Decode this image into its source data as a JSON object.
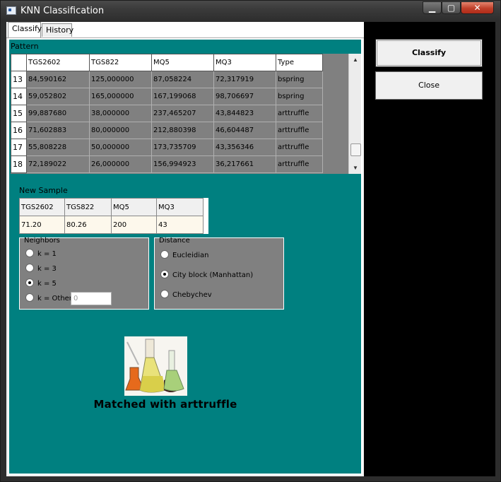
{
  "window": {
    "title": "KNN Classification",
    "min_label": "▁",
    "max_label": "▢",
    "close_label": "✕"
  },
  "tabs": [
    {
      "label": "Classify"
    },
    {
      "label": "History"
    }
  ],
  "pattern": {
    "label": "Pattern",
    "columns": [
      "TGS2602",
      "TGS822",
      "MQ5",
      "MQ3",
      "Type"
    ],
    "rows": [
      {
        "n": "13",
        "cells": [
          "84,590162",
          "125,000000",
          "87,058224",
          "72,317919",
          "bspring"
        ]
      },
      {
        "n": "14",
        "cells": [
          "59,052802",
          "165,000000",
          "167,199068",
          "98,706697",
          "bspring"
        ]
      },
      {
        "n": "15",
        "cells": [
          "99,887680",
          "38,000000",
          "237,465207",
          "43,844823",
          "arttruffle"
        ]
      },
      {
        "n": "16",
        "cells": [
          "71,602883",
          "80,000000",
          "212,880398",
          "46,604487",
          "arttruffle"
        ]
      },
      {
        "n": "17",
        "cells": [
          "55,808228",
          "50,000000",
          "173,735709",
          "43,356346",
          "arttruffle"
        ]
      },
      {
        "n": "18",
        "cells": [
          "72,189022",
          "26,000000",
          "156,994923",
          "36,217661",
          "arttruffle"
        ]
      }
    ]
  },
  "new_sample": {
    "label": "New Sample",
    "columns": [
      "TGS2602",
      "TGS822",
      "MQ5",
      "MQ3"
    ],
    "values": [
      "71.20",
      "80.26",
      "200",
      "43"
    ]
  },
  "neighbors": {
    "title": "Neighbors",
    "options": [
      "k = 1",
      "k = 3",
      "k = 5",
      "k = Other"
    ],
    "selected": "k = 5",
    "other_value": "0"
  },
  "distance": {
    "title": "Distance",
    "options": [
      "Eucleidian",
      "City block (Manhattan)",
      "Chebychev"
    ],
    "selected": "City block (Manhattan)"
  },
  "result": {
    "text": "Matched with arttruffle"
  },
  "buttons": {
    "classify": "Classify",
    "close": "Close"
  },
  "colors": {
    "panel": "#008080",
    "grid": "#808080",
    "sidebar": "#000000"
  }
}
